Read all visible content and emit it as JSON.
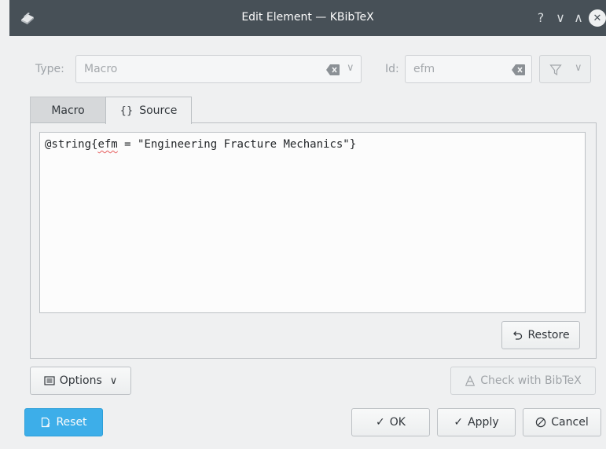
{
  "window": {
    "title": "Edit Element — KBibTeX",
    "help_glyph": "?",
    "minimize_glyph": "∨",
    "maximize_glyph": "∧",
    "close_glyph": "✕"
  },
  "header": {
    "type_label": "Type:",
    "type_value": "Macro",
    "id_label": "Id:",
    "id_value": "efm"
  },
  "tabs": [
    {
      "label": "Macro",
      "active": false
    },
    {
      "label": "Source",
      "active": true,
      "icon_glyph": "{}"
    }
  ],
  "source": {
    "prefix": "@string{",
    "misspelled": "efm",
    "suffix": " = \"Engineering Fracture Mechanics\"}"
  },
  "buttons": {
    "restore": "Restore",
    "options": "Options",
    "check": "Check with BibTeX",
    "reset": "Reset",
    "ok": "OK",
    "apply": "Apply",
    "cancel": "Cancel"
  },
  "colors": {
    "titlebar": "#475057",
    "accent": "#3daee9",
    "background": "#eff0f1"
  }
}
